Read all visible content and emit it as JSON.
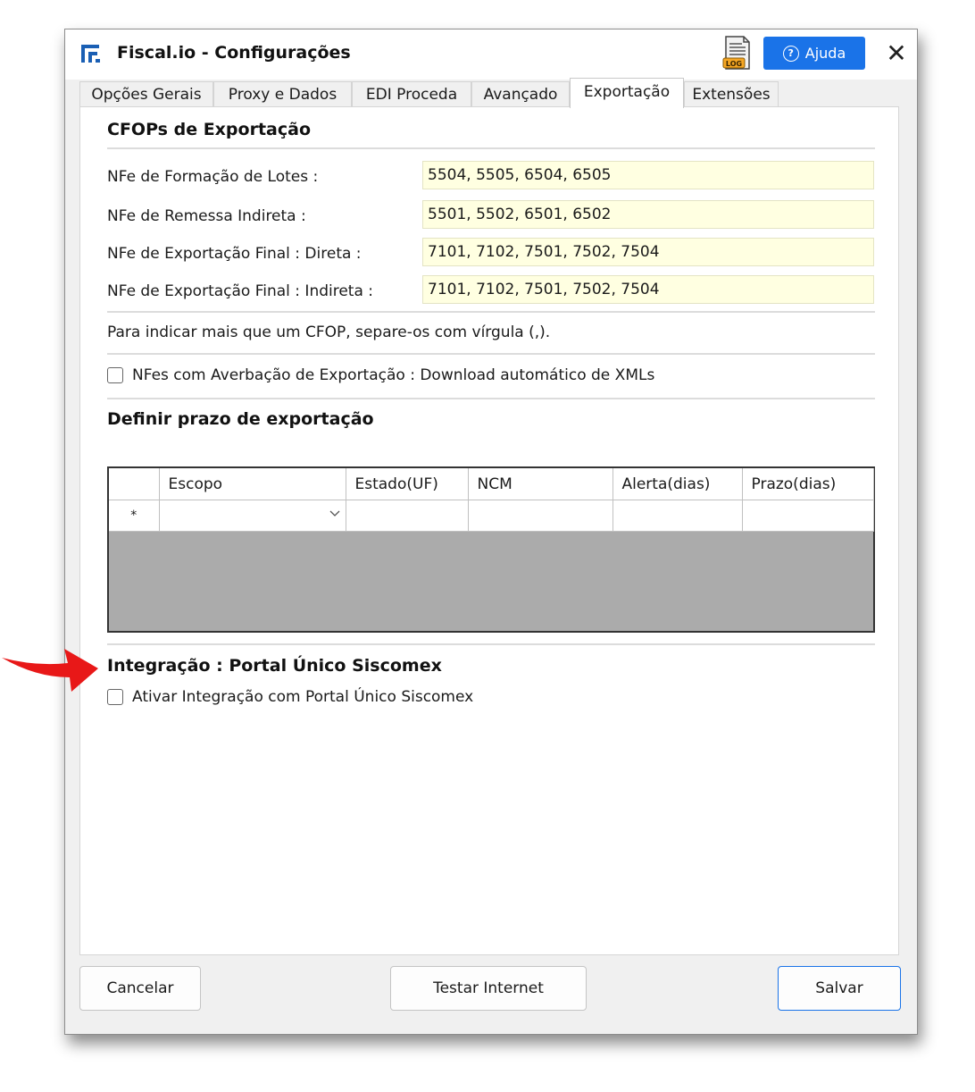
{
  "window": {
    "title": "Fiscal.io - Configurações",
    "log_icon_text": "LOG",
    "help_label": "Ajuda",
    "close_symbol": "✕"
  },
  "tabs": [
    {
      "label": "Opções Gerais",
      "active": false
    },
    {
      "label": "Proxy e Dados",
      "active": false
    },
    {
      "label": "EDI Proceda",
      "active": false
    },
    {
      "label": "Avançado",
      "active": false
    },
    {
      "label": "Exportação",
      "active": true
    },
    {
      "label": "Extensões",
      "active": false
    }
  ],
  "cfop": {
    "title": "CFOPs de Exportação",
    "fields": [
      {
        "label": "NFe de Formação de Lotes :",
        "value": "5504, 5505, 6504, 6505"
      },
      {
        "label": "NFe de Remessa Indireta :",
        "value": "5501, 5502, 6501, 6502"
      },
      {
        "label": "NFe de Exportação Final : Direta :",
        "value": "7101, 7102, 7501, 7502, 7504"
      },
      {
        "label": "NFe de Exportação Final : Indireta :",
        "value": "7101, 7102, 7501, 7502, 7504"
      }
    ],
    "note": "Para indicar mais que um CFOP, separe-os com vírgula (,).",
    "averbacao_label": "NFes com Averbação de Exportação : Download automático de XMLs",
    "averbacao_checked": false
  },
  "prazo": {
    "title": "Definir prazo de exportação",
    "columns": [
      "",
      "Escopo",
      "Estado(UF)",
      "NCM",
      "Alerta(dias)",
      "Prazo(dias)"
    ],
    "new_row_marker": "*"
  },
  "integracao": {
    "title": "Integração : Portal Único Siscomex",
    "checkbox_label": "Ativar Integração com Portal Único Siscomex",
    "checked": false
  },
  "footer": {
    "cancel": "Cancelar",
    "test": "Testar Internet",
    "save": "Salvar"
  },
  "colors": {
    "accent": "#1a73e8",
    "input_bg": "#ffffe1",
    "grid_empty": "#ababab",
    "pointer_arrow": "#e81818"
  },
  "icons": {
    "app": "fiscalio-logo-icon",
    "log": "log-file-icon",
    "help": "question-circle-icon",
    "close": "close-icon",
    "combo": "chevron-down-icon",
    "pointer": "red-arrow-icon"
  }
}
